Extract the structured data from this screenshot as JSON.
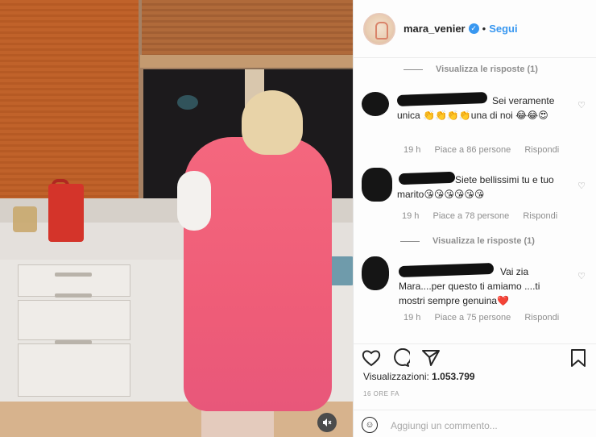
{
  "post": {
    "username": "mara_venier",
    "follow_label": "Segui",
    "dot": "•"
  },
  "comments": [
    {
      "view_replies": "Visualizza le risposte (1)",
      "text": "Sei veramente unica 👏👏👏👏una di noi 😂😂😍",
      "time": "19 h",
      "likes": "Piace a 86 persone",
      "reply": "Rispondi"
    },
    {
      "text": "Siete bellissimi tu e tuo marito😘😘😘😘😘😘",
      "time": "19 h",
      "likes": "Piace a 78 persone",
      "reply": "Rispondi",
      "view_replies": "Visualizza le risposte (1)"
    },
    {
      "text": "Vai zia Mara....per questo ti amiamo ....ti mostri sempre genuina❤️",
      "time": "19 h",
      "likes": "Piace a 75 persone",
      "reply": "Rispondi"
    }
  ],
  "views": {
    "label": "Visualizzazioni:",
    "count": "1.053.799"
  },
  "date": "16 ORE FA",
  "add_comment_placeholder": "Aggiungi un commento...",
  "icons": {
    "verified": "verified-badge-icon",
    "heart": "heart-icon",
    "comment": "comment-icon",
    "share": "share-icon",
    "bookmark": "bookmark-icon",
    "emoji": "emoji-icon",
    "mute": "mute-icon"
  },
  "colors": {
    "accent": "#3897f0",
    "meta": "#8e8e8e"
  }
}
